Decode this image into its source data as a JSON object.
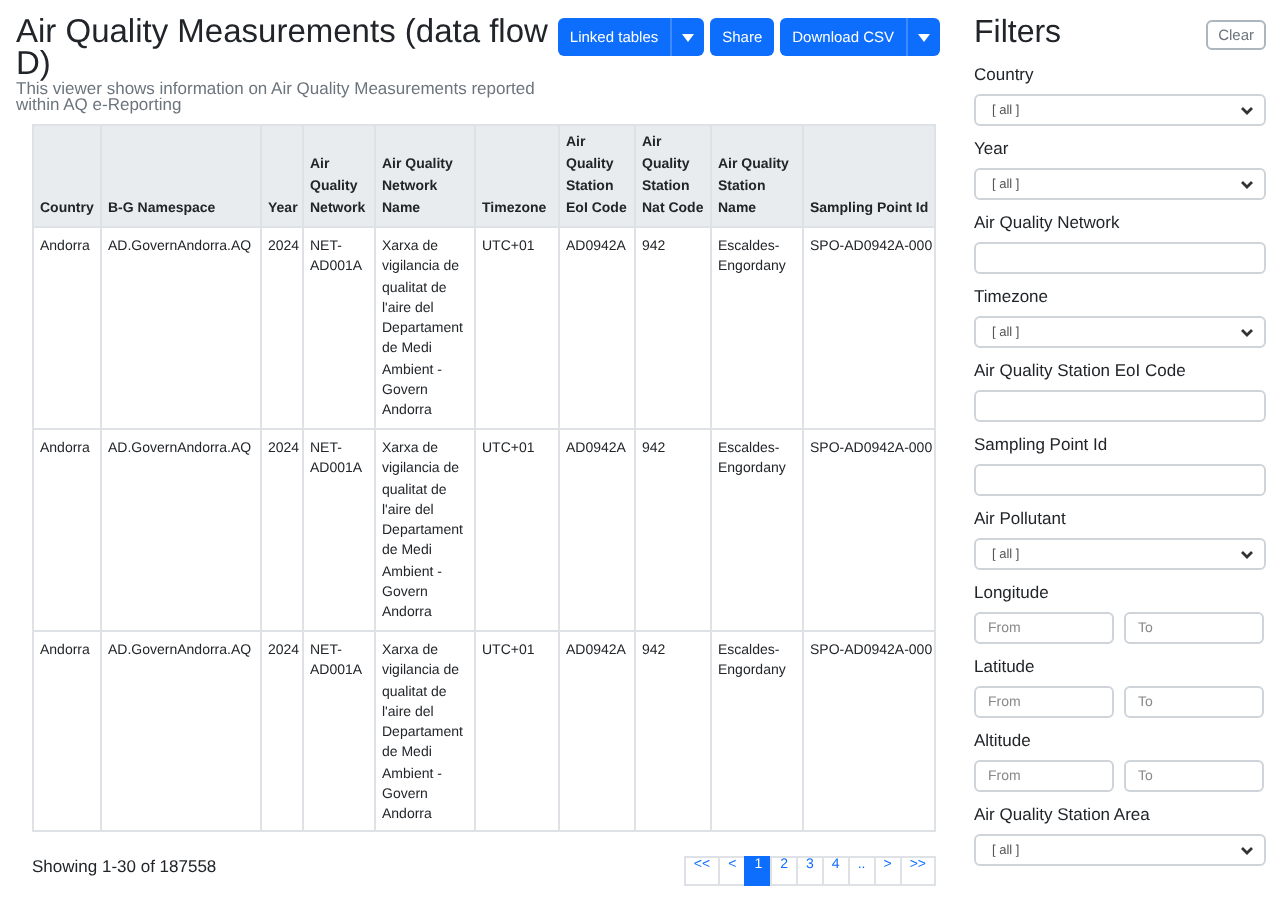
{
  "title": "Air Quality Measurements (data flow D)",
  "subtitle": "This viewer shows information on Air Quality Measurements reported within AQ e-Reporting",
  "actions": [
    {
      "label": "Linked tables",
      "dropdown": true
    },
    {
      "label": "Share",
      "dropdown": false
    },
    {
      "label": "Download CSV",
      "dropdown": true
    }
  ],
  "table": {
    "columns": [
      "Country",
      "B-G Namespace",
      "Year",
      "Air Quality Network",
      "Air Quality Network Name",
      "Timezone",
      "Air Quality Station EoI Code",
      "Air Quality Station Nat Code",
      "Air Quality Station Name",
      "Sampling Point Id"
    ],
    "rows": [
      [
        "Andorra",
        "AD.GovernAndorra.AQ",
        "2024",
        "NET-AD001A",
        "Xarxa de vigilancia de qualitat de l'aire del Departament de Medi Ambient - Govern Andorra",
        "UTC+01",
        "AD0942A",
        "942",
        "Escaldes-Engordany",
        "SPO-AD0942A-000"
      ],
      [
        "Andorra",
        "AD.GovernAndorra.AQ",
        "2024",
        "NET-AD001A",
        "Xarxa de vigilancia de qualitat de l'aire del Departament de Medi Ambient - Govern Andorra",
        "UTC+01",
        "AD0942A",
        "942",
        "Escaldes-Engordany",
        "SPO-AD0942A-000"
      ],
      [
        "Andorra",
        "AD.GovernAndorra.AQ",
        "2024",
        "NET-AD001A",
        "Xarxa de vigilancia de qualitat de l'aire del Departament de Medi Ambient - Govern Andorra",
        "UTC+01",
        "AD0942A",
        "942",
        "Escaldes-Engordany",
        "SPO-AD0942A-000"
      ]
    ]
  },
  "summary": "Showing 1-30 of 187558",
  "pagination": [
    {
      "label": "<<",
      "selected": false
    },
    {
      "label": "<",
      "selected": false
    },
    {
      "label": "1",
      "selected": true
    },
    {
      "label": "2",
      "selected": false
    },
    {
      "label": "3",
      "selected": false
    },
    {
      "label": "4",
      "selected": false
    },
    {
      "label": "..",
      "selected": false
    },
    {
      "label": ">",
      "selected": false
    },
    {
      "label": ">>",
      "selected": false
    }
  ],
  "filters": {
    "title": "Filters",
    "clear": "Clear",
    "items": [
      {
        "kind": "select",
        "label": "Country",
        "value": "[ all ]"
      },
      {
        "kind": "select",
        "label": "Year",
        "value": "[ all ]"
      },
      {
        "kind": "text",
        "label": "Air Quality Network"
      },
      {
        "kind": "select",
        "label": "Timezone",
        "value": "[ all ]"
      },
      {
        "kind": "text",
        "label": "Air Quality Station EoI Code"
      },
      {
        "kind": "text",
        "label": "Sampling Point Id"
      },
      {
        "kind": "select",
        "label": "Air Pollutant",
        "value": "[ all ]"
      },
      {
        "kind": "range",
        "label": "Longitude",
        "fields": [
          {
            "placeholder": "From"
          },
          {
            "placeholder": "To"
          }
        ]
      },
      {
        "kind": "range",
        "label": "Latitude",
        "fields": [
          {
            "placeholder": "From"
          },
          {
            "placeholder": "To"
          }
        ]
      },
      {
        "kind": "range",
        "label": "Altitude",
        "fields": [
          {
            "placeholder": "From"
          },
          {
            "placeholder": "To"
          }
        ]
      },
      {
        "kind": "select",
        "label": "Air Quality Station Area",
        "value": "[ all ]"
      }
    ]
  }
}
